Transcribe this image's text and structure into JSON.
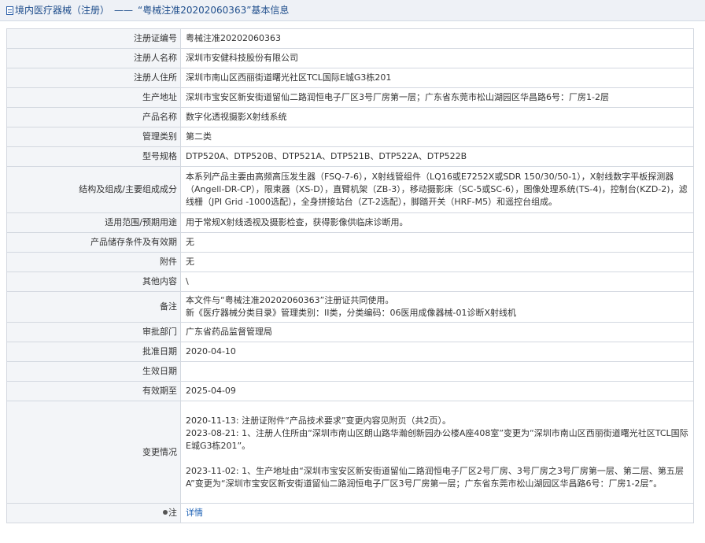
{
  "title": {
    "icon": "document-icon",
    "part1": "境内医疗器械（注册）",
    "separator": "——",
    "part2": "“粤械注准20202060363”基本信息"
  },
  "rows": [
    {
      "label": "注册证编号",
      "value": "粤械注准20202060363"
    },
    {
      "label": "注册人名称",
      "value": "深圳市安健科技股份有限公司"
    },
    {
      "label": "注册人住所",
      "value": "深圳市南山区西丽街道曙光社区TCL国际E城G3栋201"
    },
    {
      "label": "生产地址",
      "value": "深圳市宝安区新安街道留仙二路润恒电子厂区3号厂房第一层；广东省东莞市松山湖园区华昌路6号：厂房1-2层"
    },
    {
      "label": "产品名称",
      "value": "数字化透视摄影X射线系统"
    },
    {
      "label": "管理类别",
      "value": "第二类"
    },
    {
      "label": "型号规格",
      "value": "DTP520A、DTP520B、DTP521A、DTP521B、DTP522A、DTP522B"
    },
    {
      "label": "结构及组成/主要组成成分",
      "value": "本系列产品主要由高频高压发生器（FSQ-7-6），X射线管组件（LQ16或E7252X或SDR 150/30/50-1），X射线数字平板探测器（Angell-DR-CP），限束器（XS-D），直臂机架（ZB-3），移动摄影床（SC-5或SC-6），图像处理系统(TS-4)，控制台(KZD-2)，滤线栅（JPI Grid -1000选配），全身拼接站台（ZT-2选配），脚踏开关（HRF-M5）和遥控台组成。"
    },
    {
      "label": "适用范围/预期用途",
      "value": "用于常规X射线透视及摄影检查，获得影像供临床诊断用。"
    },
    {
      "label": "产品储存条件及有效期",
      "value": "无"
    },
    {
      "label": "附件",
      "value": "无"
    },
    {
      "label": "其他内容",
      "value": "\\"
    },
    {
      "label": "备注",
      "lines": [
        "本文件与“粤械注准20202060363”注册证共同使用。",
        "新《医疗器械分类目录》管理类别：II类，分类编码：06医用成像器械-01诊断X射线机"
      ]
    },
    {
      "label": "审批部门",
      "value": "广东省药品监督管理局"
    },
    {
      "label": "批准日期",
      "value": "2020-04-10"
    },
    {
      "label": "生效日期",
      "value": ""
    },
    {
      "label": "有效期至",
      "value": "2025-04-09"
    }
  ],
  "changes": {
    "label": "变更情况",
    "items": [
      "2020-11-13: 注册证附件“产品技术要求”变更内容见附页（共2页）。",
      "2023-08-21: 1、注册人住所由“深圳市南山区朗山路华瀚创新园办公楼A座408室”变更为“深圳市南山区西丽街道曙光社区TCL国际E城G3栋201”。",
      "2023-11-02: 1、生产地址由“深圳市宝安区新安街道留仙二路润恒电子厂区2号厂房、3号厂房之3号厂房第一层、第二层、第五层A”变更为“深圳市宝安区新安街道留仙二路润恒电子厂区3号厂房第一层；广东省东莞市松山湖园区华昌路6号：厂房1-2层”。"
    ]
  },
  "note": {
    "icon": "pin-icon",
    "label": "注",
    "link": "详情"
  }
}
